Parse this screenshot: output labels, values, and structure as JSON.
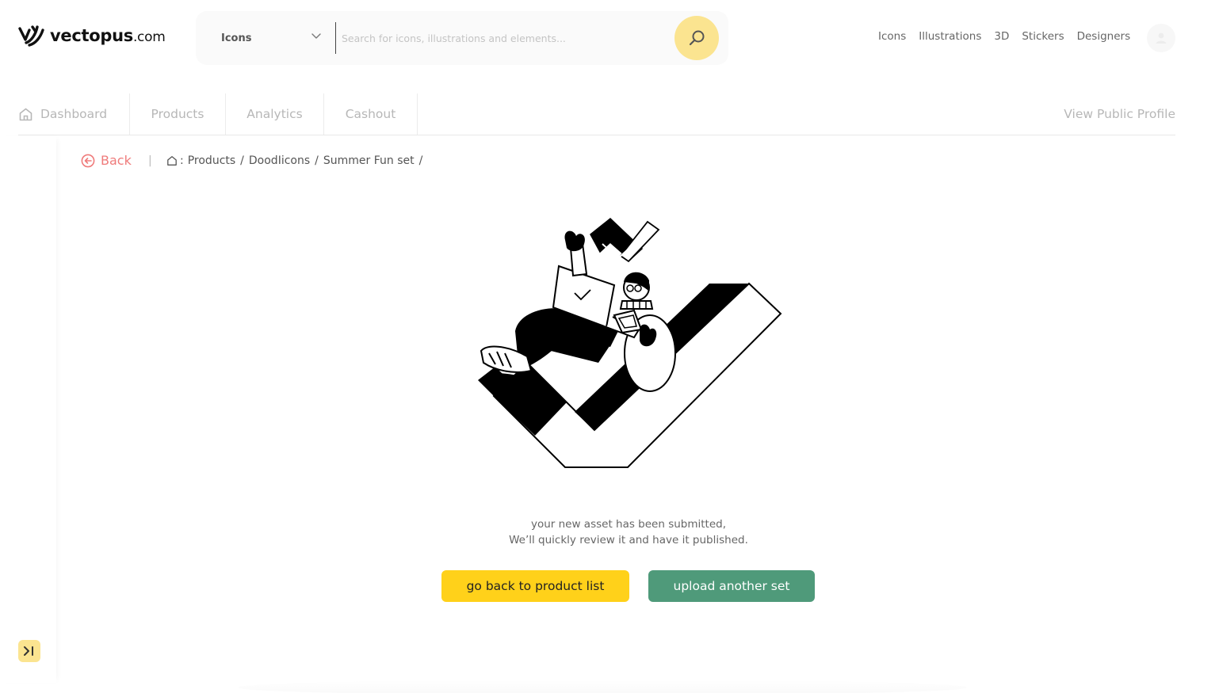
{
  "brand": {
    "name": "vectopus",
    "tld": ".com"
  },
  "search": {
    "type_selected": "Icons",
    "placeholder": "Search for icons, illustrations and elements..."
  },
  "topnav": [
    "Icons",
    "Illustrations",
    "3D",
    "Stickers",
    "Designers"
  ],
  "tabs": {
    "dashboard": "Dashboard",
    "products": "Products",
    "analytics": "Analytics",
    "cashout": "Cashout",
    "view_public_profile": "View Public Profile"
  },
  "breadcrumb": {
    "back_label": "Back",
    "separator": "|",
    "prefix": ":",
    "items": [
      "Products",
      "DoodIicons",
      "Summer Fun set"
    ],
    "slash": "/"
  },
  "message": {
    "line1": "your new asset has been submitted,",
    "line2": "We’ll quickly review it and have it published."
  },
  "buttons": {
    "back_to_list": "go back to product list",
    "upload_another": "upload another set"
  },
  "colors": {
    "accent_yellow": "#ffd11a",
    "soft_yellow": "#fbe490",
    "green": "#4f9a7a",
    "back_red": "#ef7b7b"
  }
}
